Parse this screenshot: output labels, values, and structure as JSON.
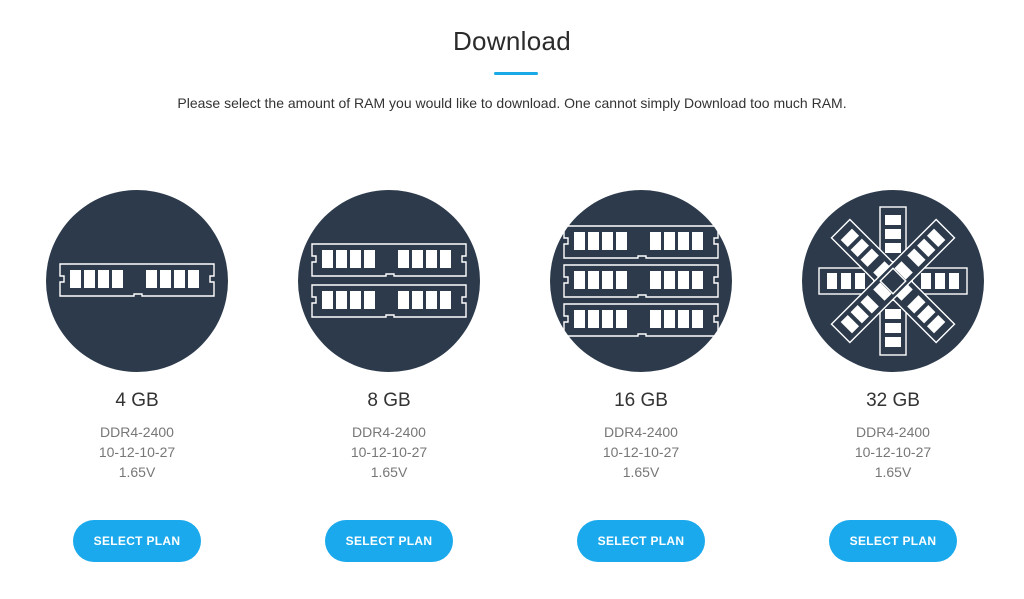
{
  "header": {
    "title": "Download",
    "subtitle": "Please select the amount of RAM you would like to download. One cannot simply Download too much RAM."
  },
  "colors": {
    "accent": "#1aa9ec",
    "circle": "#2c3a4b"
  },
  "plans": [
    {
      "name": "4 GB",
      "type": "DDR4-2400",
      "timings": "10-12-10-27",
      "voltage": "1.65V",
      "button_label": "SELECT PLAN",
      "icon": "ram-stick-icon-single"
    },
    {
      "name": "8 GB",
      "type": "DDR4-2400",
      "timings": "10-12-10-27",
      "voltage": "1.65V",
      "button_label": "SELECT PLAN",
      "icon": "ram-stick-icon-double"
    },
    {
      "name": "16 GB",
      "type": "DDR4-2400",
      "timings": "10-12-10-27",
      "voltage": "1.65V",
      "button_label": "SELECT PLAN",
      "icon": "ram-stick-icon-triple"
    },
    {
      "name": "32 GB",
      "type": "DDR4-2400",
      "timings": "10-12-10-27",
      "voltage": "1.65V",
      "button_label": "SELECT PLAN",
      "icon": "ram-stick-icon-star"
    }
  ]
}
